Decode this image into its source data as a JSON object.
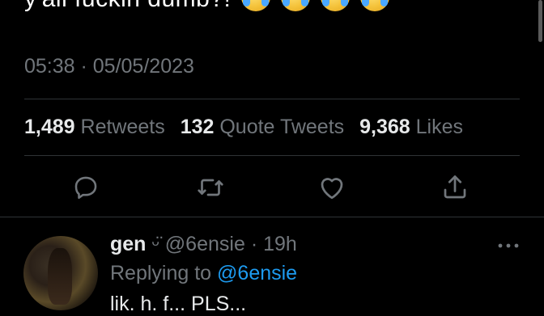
{
  "tweet": {
    "text": "y'all fuckin dumb?!",
    "time": "05:38 · 05/05/2023"
  },
  "stats": {
    "retweets_count": "1,489",
    "retweets_label": "Retweets",
    "quote_count": "132",
    "quote_label": "Quote Tweets",
    "likes_count": "9,368",
    "likes_label": "Likes"
  },
  "actions": [
    "reply-icon",
    "retweet-icon",
    "like-icon",
    "share-icon"
  ],
  "reply": {
    "name": "gen",
    "badge": "ᵕ̈",
    "handle": "@6ensie",
    "age": "19h",
    "replying_prefix": "Replying to",
    "replying_handle": "@6ensie",
    "text": "lik. h. f... PLS..."
  },
  "colors": {
    "background": "#000000",
    "text_primary": "#e7e9ea",
    "text_secondary": "#71767b",
    "accent": "#1d9bf0",
    "divider": "#2f3336"
  }
}
